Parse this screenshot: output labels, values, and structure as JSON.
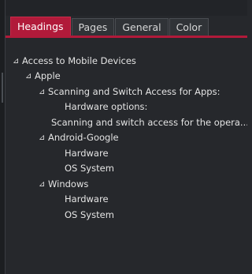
{
  "tabs": [
    {
      "label": "Headings",
      "active": true
    },
    {
      "label": "Pages",
      "active": false
    },
    {
      "label": "General",
      "active": false
    },
    {
      "label": "Color",
      "active": false
    }
  ],
  "tree": {
    "nodes": [
      {
        "label": "Access to Mobile Devices",
        "expander": "⊿"
      },
      {
        "label": "Apple",
        "expander": "⊿"
      },
      {
        "label": "Scanning and Switch Access for Apps:",
        "expander": "⊿"
      },
      {
        "label": "Hardware options:",
        "expander": ""
      },
      {
        "label": "Scanning and switch access for the opera...",
        "expander": ""
      },
      {
        "label": "Android-Google",
        "expander": "⊿"
      },
      {
        "label": "Hardware",
        "expander": ""
      },
      {
        "label": "OS System",
        "expander": ""
      },
      {
        "label": "Windows",
        "expander": "⊿"
      },
      {
        "label": "Hardware",
        "expander": ""
      },
      {
        "label": "OS System",
        "expander": ""
      }
    ]
  },
  "colors": {
    "accent": "#b11a3a",
    "background": "#26282c",
    "text": "#e4e4e4"
  }
}
